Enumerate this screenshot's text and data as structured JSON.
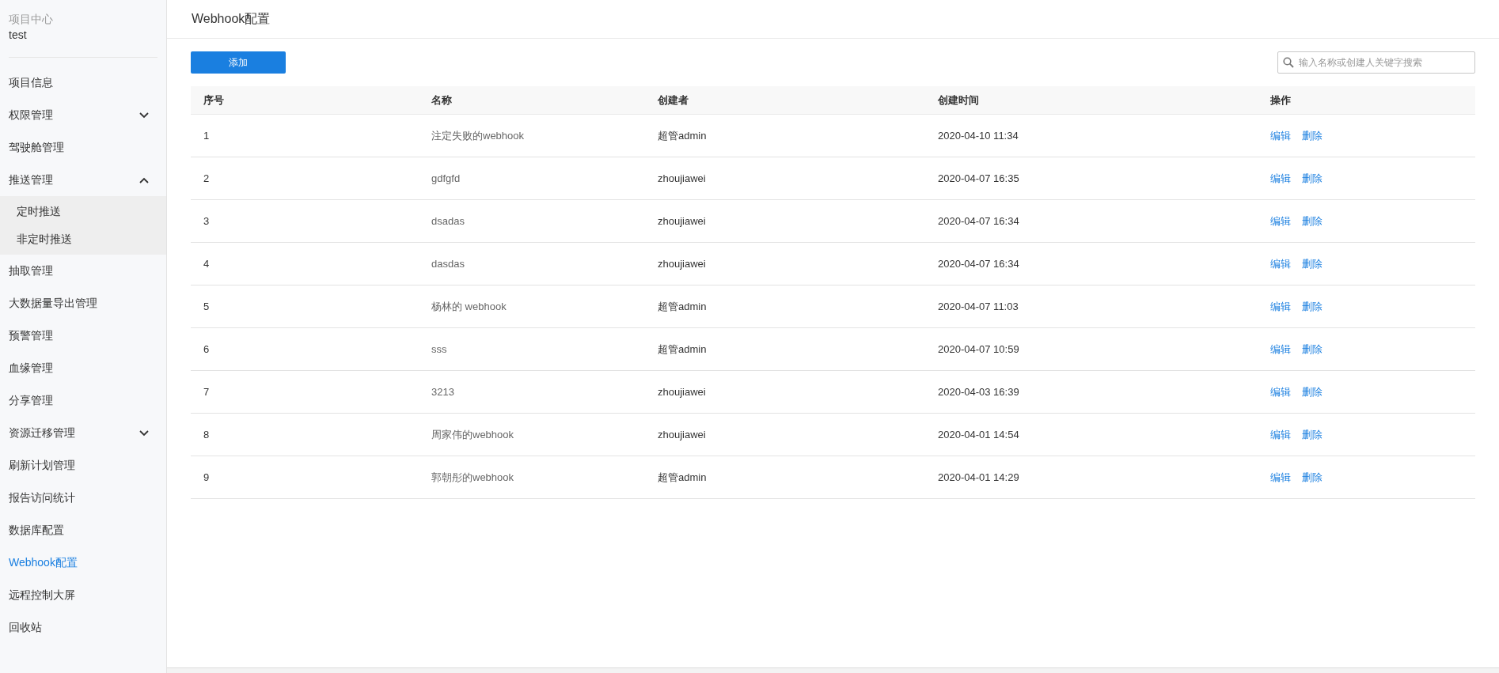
{
  "sidebar": {
    "project_label": "项目中心",
    "project_name": "test",
    "items": [
      {
        "label": "项目信息",
        "selected": false
      },
      {
        "label": "权限管理",
        "selected": false,
        "expanded": false
      },
      {
        "label": "驾驶舱管理",
        "selected": false
      },
      {
        "label": "推送管理",
        "selected": false,
        "expanded": true,
        "children": [
          {
            "label": "定时推送",
            "selected": false
          },
          {
            "label": "非定时推送",
            "selected": false
          }
        ]
      },
      {
        "label": "抽取管理",
        "selected": false
      },
      {
        "label": "大数据量导出管理",
        "selected": false
      },
      {
        "label": "预警管理",
        "selected": false
      },
      {
        "label": "血缘管理",
        "selected": false
      },
      {
        "label": "分享管理",
        "selected": false
      },
      {
        "label": "资源迁移管理",
        "selected": false,
        "expanded": false
      },
      {
        "label": "刷新计划管理",
        "selected": false
      },
      {
        "label": "报告访问统计",
        "selected": false
      },
      {
        "label": "数据库配置",
        "selected": false
      },
      {
        "label": "Webhook配置",
        "selected": true
      },
      {
        "label": "远程控制大屏",
        "selected": false
      },
      {
        "label": "回收站",
        "selected": false
      }
    ]
  },
  "page_title": "Webhook配置",
  "add_button": "添加",
  "search": {
    "placeholder": "输入名称或创建人关键字搜索"
  },
  "table": {
    "columns": [
      "序号",
      "名称",
      "创建者",
      "创建时间",
      "操作"
    ],
    "rows": [
      {
        "index": "1",
        "name": "注定失败的webhook",
        "creator": "超管admin",
        "created": "2020-04-10 11:34",
        "actions": [
          "编辑",
          "删除"
        ]
      },
      {
        "index": "2",
        "name": "gdfgfd",
        "creator": "zhoujiawei",
        "created": "2020-04-07 16:35",
        "actions": [
          "编辑",
          "删除"
        ]
      },
      {
        "index": "3",
        "name": "dsadas",
        "creator": "zhoujiawei",
        "created": "2020-04-07 16:34",
        "actions": [
          "编辑",
          "删除"
        ]
      },
      {
        "index": "4",
        "name": "dasdas",
        "creator": "zhoujiawei",
        "created": "2020-04-07 16:34",
        "actions": [
          "编辑",
          "删除"
        ]
      },
      {
        "index": "5",
        "name": "杨林的 webhook",
        "creator": "超管admin",
        "created": "2020-04-07 11:03",
        "actions": [
          "编辑",
          "删除"
        ]
      },
      {
        "index": "6",
        "name": "sss",
        "creator": "超管admin",
        "created": "2020-04-07 10:59",
        "actions": [
          "编辑",
          "删除"
        ]
      },
      {
        "index": "7",
        "name": "3213",
        "creator": "zhoujiawei",
        "created": "2020-04-03 16:39",
        "actions": [
          "编辑",
          "删除"
        ]
      },
      {
        "index": "8",
        "name": "周家伟的webhook",
        "creator": "zhoujiawei",
        "created": "2020-04-01 14:54",
        "actions": [
          "编辑",
          "删除"
        ]
      },
      {
        "index": "9",
        "name": "郭朝彤的webhook",
        "creator": "超管admin",
        "created": "2020-04-01 14:29",
        "actions": [
          "编辑",
          "删除"
        ]
      }
    ]
  }
}
